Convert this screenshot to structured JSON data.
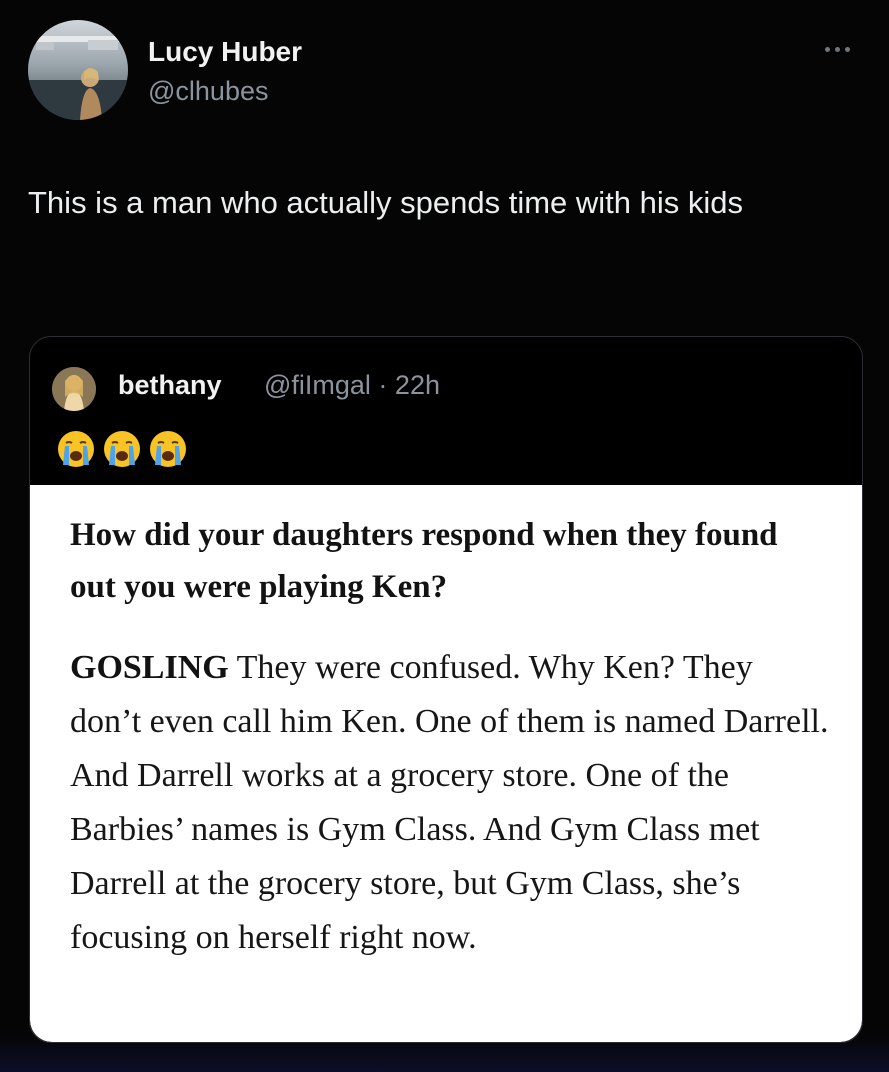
{
  "tweet": {
    "author": {
      "name": "Lucy Huber",
      "handle": "@clhubes"
    },
    "text": "This is a man who actually spends time with his kids",
    "quoted": {
      "author_name": "bethany",
      "meta": "@fiImgal · 22h",
      "emojis": [
        "crying-face-emoji",
        "crying-face-emoji",
        "crying-face-emoji"
      ],
      "image": {
        "question": "How did your daughters respond when they found out you were playing Ken?",
        "speaker": "GOSLING",
        "answer": " They were confused. Why Ken? They don’t even call him Ken. One of them is named Darrell. And Darrell works at a grocery store. One of the Barbies’ names is Gym Class. And Gym Class met Darrell at the grocery store, but Gym Class, she’s focusing on herself right now."
      }
    }
  },
  "colors": {
    "background": "#050505",
    "primary_text": "#eceef0",
    "secondary_text": "#8b949c",
    "card_border": "#2c3034",
    "excerpt_background": "#ffffff",
    "excerpt_text": "#161616",
    "emoji_yellow": "#f7c325",
    "emoji_tears": "#4fa3e8"
  },
  "icons": {
    "more": "more-horizontal-icon"
  }
}
